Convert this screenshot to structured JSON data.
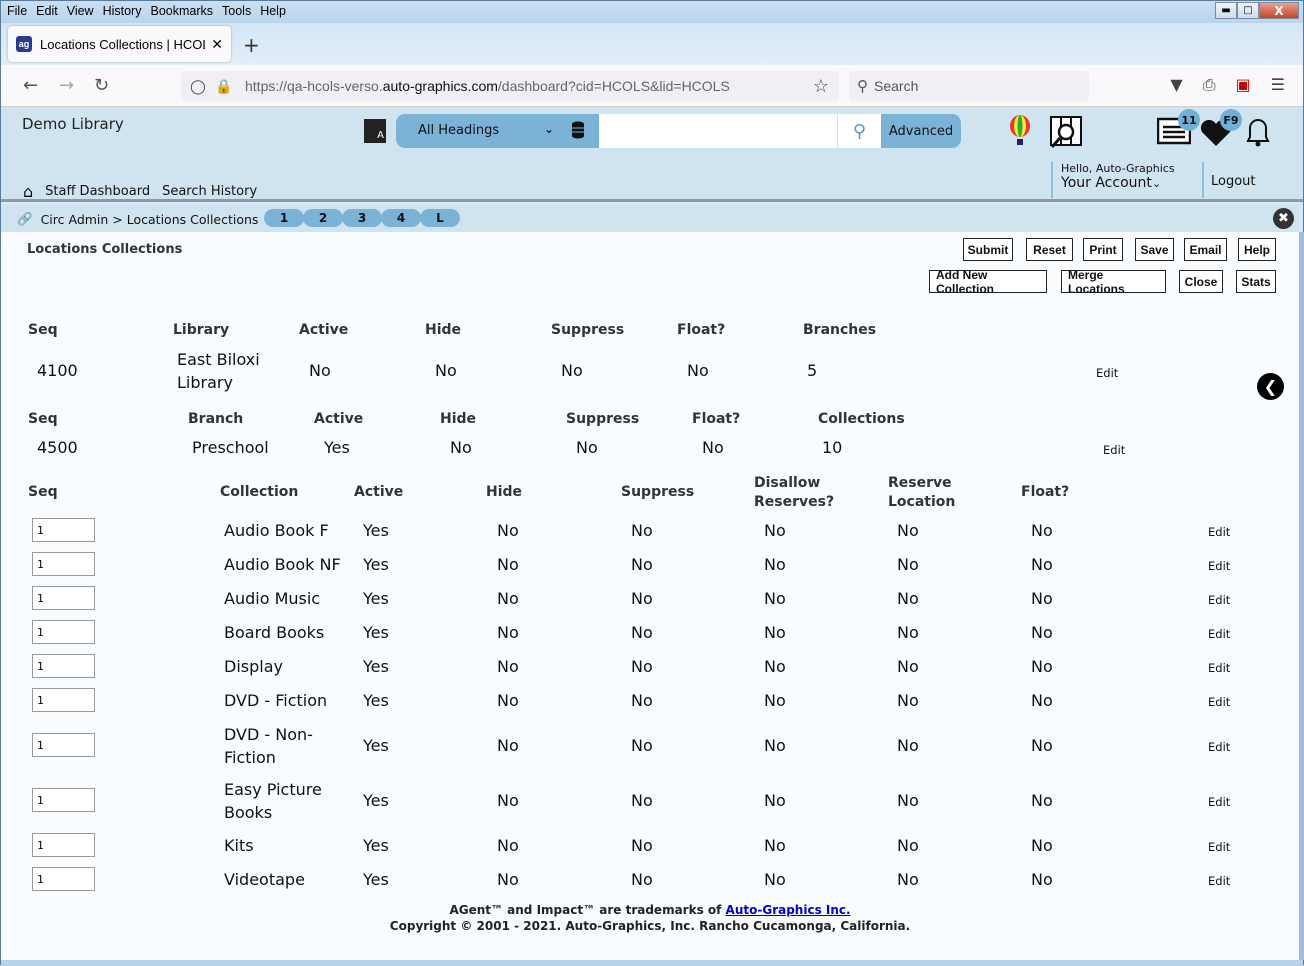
{
  "browser": {
    "menu": [
      "File",
      "Edit",
      "View",
      "History",
      "Bookmarks",
      "Tools",
      "Help"
    ],
    "tab_title": "Locations Collections | HCOLS |",
    "url_prefix": "https://qa-hcols-verso.",
    "url_domain": "auto-graphics.com",
    "url_suffix": "/dashboard?cid=HCOLS&lid=HCOLS",
    "search_placeholder": "Search"
  },
  "header": {
    "library_name": "Demo Library",
    "search_scope": "All Headings",
    "search_value": "",
    "advanced_label": "Advanced",
    "list_badge": "11",
    "favorites_badge": "F9",
    "nav": {
      "staff_dashboard": "Staff Dashboard",
      "search_history": "Search History"
    },
    "greeting": "Hello, Auto-Graphics",
    "account_label": "Your Account",
    "logout_label": "Logout"
  },
  "breadcrumb": {
    "text": "Circ Admin > Locations Collections",
    "pills": [
      "1",
      "2",
      "3",
      "4",
      "L"
    ]
  },
  "page": {
    "title": "Locations Collections",
    "buttons_row1": [
      "Submit",
      "Reset",
      "Print",
      "Save",
      "Email",
      "Help"
    ],
    "buttons_row2": [
      "Add New Collection",
      "Merge Locations",
      "Close",
      "Stats"
    ]
  },
  "library_section": {
    "headers": [
      "Seq",
      "Library",
      "Active",
      "Hide",
      "Suppress",
      "Float?",
      "Branches"
    ],
    "row": {
      "seq": "4100",
      "name_line1": "East Biloxi",
      "name_line2": "Library",
      "active": "No",
      "hide": "No",
      "suppress": "No",
      "float": "No",
      "branches": "5",
      "edit": "Edit"
    }
  },
  "branch_section": {
    "headers": [
      "Seq",
      "Branch",
      "Active",
      "Hide",
      "Suppress",
      "Float?",
      "Collections"
    ],
    "row": {
      "seq": "4500",
      "name": "Preschool",
      "active": "Yes",
      "hide": "No",
      "suppress": "No",
      "float": "No",
      "collections": "10",
      "edit": "Edit"
    }
  },
  "collections_section": {
    "headers": {
      "seq": "Seq",
      "collection": "Collection",
      "active": "Active",
      "hide": "Hide",
      "suppress": "Suppress",
      "disallow_1": "Disallow",
      "disallow_2": "Reserves?",
      "reserve_1": "Reserve",
      "reserve_2": "Location",
      "float": "Float?"
    },
    "rows": [
      {
        "seq": "1",
        "l1": "Audio Book F",
        "l2": "",
        "active": "Yes",
        "hide": "No",
        "suppress": "No",
        "disallow": "No",
        "reserve": "No",
        "float": "No",
        "edit": "Edit"
      },
      {
        "seq": "1",
        "l1": "Audio Book NF",
        "l2": "",
        "active": "Yes",
        "hide": "No",
        "suppress": "No",
        "disallow": "No",
        "reserve": "No",
        "float": "No",
        "edit": "Edit"
      },
      {
        "seq": "1",
        "l1": "Audio Music",
        "l2": "",
        "active": "Yes",
        "hide": "No",
        "suppress": "No",
        "disallow": "No",
        "reserve": "No",
        "float": "No",
        "edit": "Edit"
      },
      {
        "seq": "1",
        "l1": "Board Books",
        "l2": "",
        "active": "Yes",
        "hide": "No",
        "suppress": "No",
        "disallow": "No",
        "reserve": "No",
        "float": "No",
        "edit": "Edit"
      },
      {
        "seq": "1",
        "l1": "Display",
        "l2": "",
        "active": "Yes",
        "hide": "No",
        "suppress": "No",
        "disallow": "No",
        "reserve": "No",
        "float": "No",
        "edit": "Edit"
      },
      {
        "seq": "1",
        "l1": "DVD - Fiction",
        "l2": "",
        "active": "Yes",
        "hide": "No",
        "suppress": "No",
        "disallow": "No",
        "reserve": "No",
        "float": "No",
        "edit": "Edit"
      },
      {
        "seq": "1",
        "l1": "DVD - Non-",
        "l2": "Fiction",
        "active": "Yes",
        "hide": "No",
        "suppress": "No",
        "disallow": "No",
        "reserve": "No",
        "float": "No",
        "edit": "Edit"
      },
      {
        "seq": "1",
        "l1": "Easy Picture",
        "l2": "Books",
        "active": "Yes",
        "hide": "No",
        "suppress": "No",
        "disallow": "No",
        "reserve": "No",
        "float": "No",
        "edit": "Edit"
      },
      {
        "seq": "1",
        "l1": "Kits",
        "l2": "",
        "active": "Yes",
        "hide": "No",
        "suppress": "No",
        "disallow": "No",
        "reserve": "No",
        "float": "No",
        "edit": "Edit"
      },
      {
        "seq": "1",
        "l1": "Videotape",
        "l2": "",
        "active": "Yes",
        "hide": "No",
        "suppress": "No",
        "disallow": "No",
        "reserve": "No",
        "float": "No",
        "edit": "Edit"
      }
    ]
  },
  "footer": {
    "trademark_text": "AGent™ and Impact™ are trademarks of ",
    "trademark_link": "Auto-Graphics Inc.",
    "copyright": "Copyright © 2001 - 2021. Auto-Graphics, Inc. Rancho Cucamonga, California."
  }
}
